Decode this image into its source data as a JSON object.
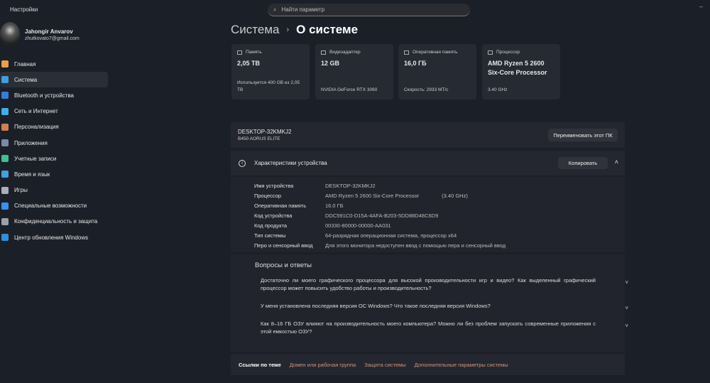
{
  "window": {
    "title": "Настройки",
    "minimize": "–"
  },
  "search": {
    "placeholder": "Найти параметр"
  },
  "user": {
    "name": "Jahongir Anvarov",
    "email": "zhutkovato7@gmail.com"
  },
  "sidebar": {
    "items": [
      {
        "label": "Главная",
        "color": "#e8a04a"
      },
      {
        "label": "Система",
        "color": "#3aa0e0"
      },
      {
        "label": "Bluetooth и устройства",
        "color": "#2f7fe0"
      },
      {
        "label": "Сеть и Интернет",
        "color": "#3ab0f0"
      },
      {
        "label": "Персонализация",
        "color": "#d08050"
      },
      {
        "label": "Приложения",
        "color": "#7a8aa8"
      },
      {
        "label": "Учетные записи",
        "color": "#3cc090"
      },
      {
        "label": "Время и язык",
        "color": "#40a0e0"
      },
      {
        "label": "Игры",
        "color": "#aab0bb"
      },
      {
        "label": "Специальные возможности",
        "color": "#3a90f0"
      },
      {
        "label": "Конфиденциальность и защита",
        "color": "#9aa0aa"
      },
      {
        "label": "Центр обновления Windows",
        "color": "#2a90e0"
      }
    ]
  },
  "breadcrumb": {
    "parent": "Система",
    "sep": "›",
    "current": "О системе"
  },
  "cards": [
    {
      "label": "Память",
      "value": "2,05 TB",
      "sub": "Используется 400 GB из 2,05 TB"
    },
    {
      "label": "Видеоадаптер",
      "value": "12 GB",
      "sub": "NVIDIA GeForce RTX 3060"
    },
    {
      "label": "Оперативная память",
      "value": "16,0 ГБ",
      "sub": "Скорость: 2933 МТ/с"
    },
    {
      "label": "Процессор",
      "value": "AMD Ryzen 5 2600 Six-Core Processor",
      "sub": "3.40 GHz"
    }
  ],
  "device": {
    "name": "DESKTOP-32KMKJ2",
    "model": "B450 AORUS ELITE",
    "rename": "Переименовать этот ПК"
  },
  "specs": {
    "title": "Характеристики устройства",
    "copy": "Копировать",
    "rows": [
      {
        "k": "Имя устройства",
        "v": "DESKTOP-32KMKJ2"
      },
      {
        "k": "Процессор",
        "v": "AMD Ryzen 5 2600 Six-Core Processor",
        "v2": "(3.40 GHz)"
      },
      {
        "k": "Оперативная память",
        "v": "16.0 ГБ"
      },
      {
        "k": "Код устройства",
        "v": "DDC591C0-D15A-4AFA-B203-5DD88D48C6D9"
      },
      {
        "k": "Код продукта",
        "v": "00330-80000-00000-AA031"
      },
      {
        "k": "Тип системы",
        "v": "64-разрядная операционная система, процессор x64"
      },
      {
        "k": "Перо и сенсорный ввод",
        "v": "Для этого монитора недоступен ввод с помощью пера и сенсорный ввод"
      }
    ]
  },
  "faq": {
    "title": "Вопросы и ответы",
    "items": [
      "Достаточно ли моего графического процессора для высокой производительности игр и видео? Как выделенный графический процессор может повысить удобство работы и производительность?",
      "У меня установлена последняя версия ОС Windows? Что такое последняя версия Windows?",
      "Как 8–16 ГБ ОЗУ влияют на производительность моего компьютера? Можно ли без проблем запускать современные приложения с этой емкостью ОЗУ?"
    ]
  },
  "links": {
    "title": "Ссылки по теме",
    "items": [
      "Домен или рабочая группа",
      "Защита системы",
      "Дополнительные параметры системы"
    ]
  }
}
